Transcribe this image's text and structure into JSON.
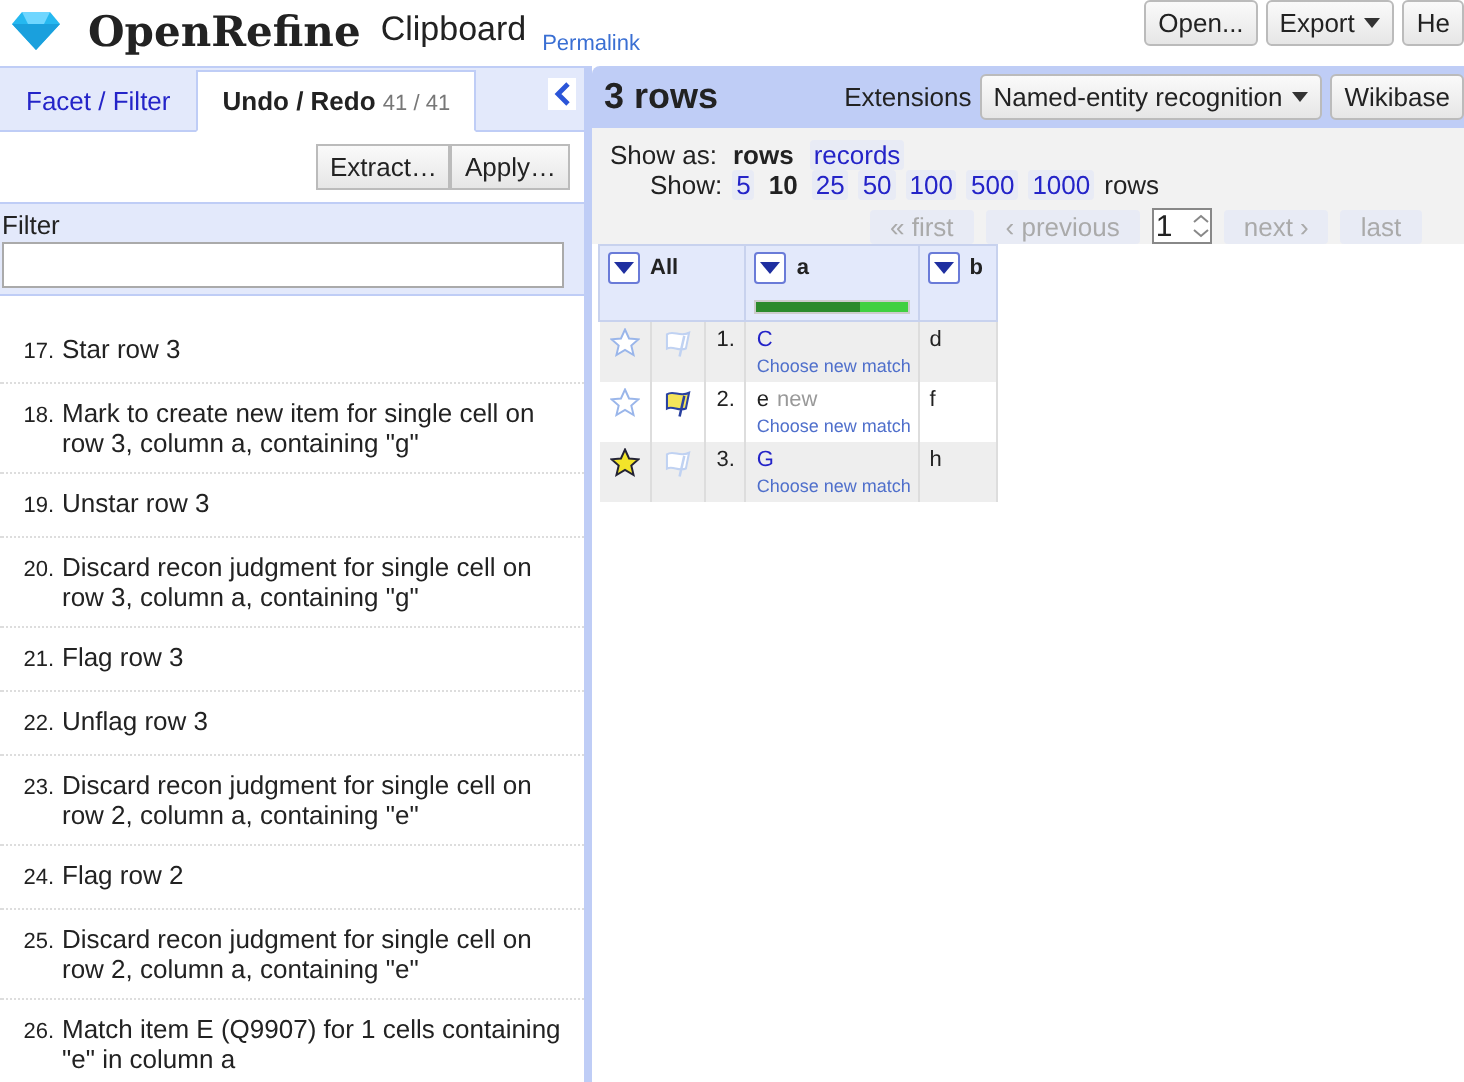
{
  "header": {
    "logo": "OpenRefine",
    "project": "Clipboard",
    "permalink": "Permalink",
    "buttons": [
      {
        "label": "Open...",
        "kind": "plain"
      },
      {
        "label": "Export",
        "kind": "dropdown"
      },
      {
        "label": "He",
        "kind": "plain"
      }
    ]
  },
  "left": {
    "tabs": [
      {
        "label": "Facet / Filter",
        "selected": false
      },
      {
        "label": "Undo / Redo",
        "count": "41 / 41",
        "selected": true
      }
    ],
    "actions": [
      "Extract…",
      "Apply…"
    ],
    "filter": {
      "label": "Filter"
    },
    "history": [
      {
        "number": "17.",
        "text": "Star row 3"
      },
      {
        "number": "18.",
        "text": "Mark to create new item for single cell on row 3, column a, containing \"g\""
      },
      {
        "number": "19.",
        "text": "Unstar row 3"
      },
      {
        "number": "20.",
        "text": "Discard recon judgment for single cell on row 3, column a, containing \"g\""
      },
      {
        "number": "21.",
        "text": "Flag row 3"
      },
      {
        "number": "22.",
        "text": "Unflag row 3"
      },
      {
        "number": "23.",
        "text": "Discard recon judgment for single cell on row 2, column a, containing \"e\""
      },
      {
        "number": "24.",
        "text": "Flag row 2"
      },
      {
        "number": "25.",
        "text": "Discard recon judgment for single cell on row 2, column a, containing \"e\""
      },
      {
        "number": "26.",
        "text": "Match item E (Q9907) for 1 cells containing \"e\" in column a"
      }
    ]
  },
  "right": {
    "title": "3 rows",
    "extensions_label": "Extensions",
    "extension_buttons": [
      {
        "label": "Named-entity recognition",
        "kind": "dropdown"
      },
      {
        "label": "Wikibase",
        "kind": "plain"
      }
    ],
    "show_as": {
      "label": "Show as:",
      "options": [
        {
          "label": "rows",
          "selected": true
        },
        {
          "label": "records",
          "selected": false
        }
      ]
    },
    "show": {
      "label": "Show:",
      "options": [
        {
          "label": "5",
          "selected": false
        },
        {
          "label": "10",
          "selected": true
        },
        {
          "label": "25",
          "selected": false
        },
        {
          "label": "50",
          "selected": false
        },
        {
          "label": "100",
          "selected": false
        },
        {
          "label": "500",
          "selected": false
        },
        {
          "label": "1000",
          "selected": false
        }
      ],
      "suffix": "rows"
    },
    "pager": {
      "first": "« first",
      "previous": "‹ previous",
      "page": "1",
      "next": "next ›",
      "last": "last"
    },
    "table": {
      "columns": [
        {
          "label": "All",
          "kind": "all"
        },
        {
          "label": "a",
          "kind": "recon",
          "level": 0.68
        },
        {
          "label": "b",
          "kind": "plain"
        }
      ],
      "rows": [
        {
          "starred": false,
          "flagged": false,
          "index": "1.",
          "a": {
            "text": "C",
            "kind": "matched",
            "action": "Choose new match"
          },
          "b": "d"
        },
        {
          "starred": false,
          "flagged": true,
          "index": "2.",
          "a": {
            "text": "e",
            "kind": "new",
            "note": "new",
            "action": "Choose new match"
          },
          "b": "f"
        },
        {
          "starred": true,
          "flagged": false,
          "index": "3.",
          "a": {
            "text": "G",
            "kind": "matched",
            "action": "Choose new match"
          },
          "b": "h"
        }
      ]
    }
  }
}
